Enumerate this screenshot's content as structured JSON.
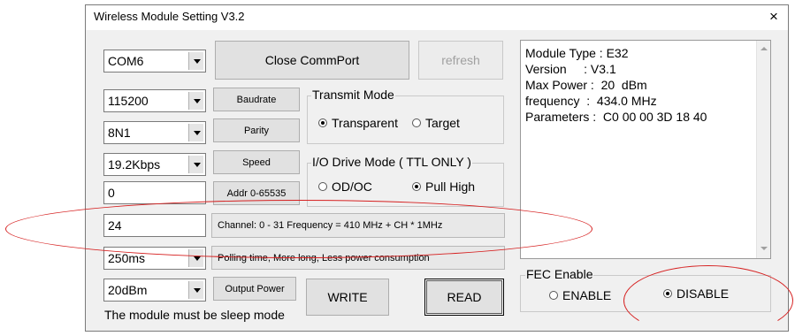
{
  "window": {
    "title": "Wireless Module Setting V3.2",
    "close_glyph": "×"
  },
  "left": {
    "port": "COM6",
    "baud_value": "115200",
    "baud_button": "Baudrate",
    "parity_value": "8N1",
    "parity_button": "Parity",
    "speed_value": "19.2Kbps",
    "speed_button": "Speed",
    "addr_value": "0",
    "addr_button": "Addr 0-65535",
    "channel_value": "24",
    "channel_label": "Channel: 0 - 31 Frequency = 410 MHz + CH * 1MHz",
    "polling_value": "250ms",
    "polling_label": "Polling time, More long, Less power consumption",
    "power_value": "20dBm",
    "power_button": "Output Power",
    "note": "The module must be sleep mode"
  },
  "buttons": {
    "close_port": "Close CommPort",
    "refresh": "refresh",
    "write": "WRITE",
    "read": "READ"
  },
  "transmit_mode": {
    "title": "Transmit Mode",
    "options": [
      {
        "label": "Transparent",
        "selected": true
      },
      {
        "label": "Target",
        "selected": false
      }
    ]
  },
  "io_mode": {
    "title": "I/O Drive Mode ( TTL ONLY )",
    "options": [
      {
        "label": "OD/OC",
        "selected": false
      },
      {
        "label": "Pull High",
        "selected": true
      }
    ]
  },
  "info": {
    "lines": [
      "Module Type : E32",
      "Version     : V3.1",
      "Max Power :  20  dBm",
      "frequency  :  434.0 MHz",
      "Parameters :  C0 00 00 3D 18 40"
    ]
  },
  "fec": {
    "title": "FEC Enable",
    "options": [
      {
        "label": "ENABLE",
        "selected": false
      },
      {
        "label": "DISABLE",
        "selected": true
      }
    ]
  },
  "colors": {
    "annotation": "#d62020",
    "window_bg": "#f0f0f0"
  }
}
